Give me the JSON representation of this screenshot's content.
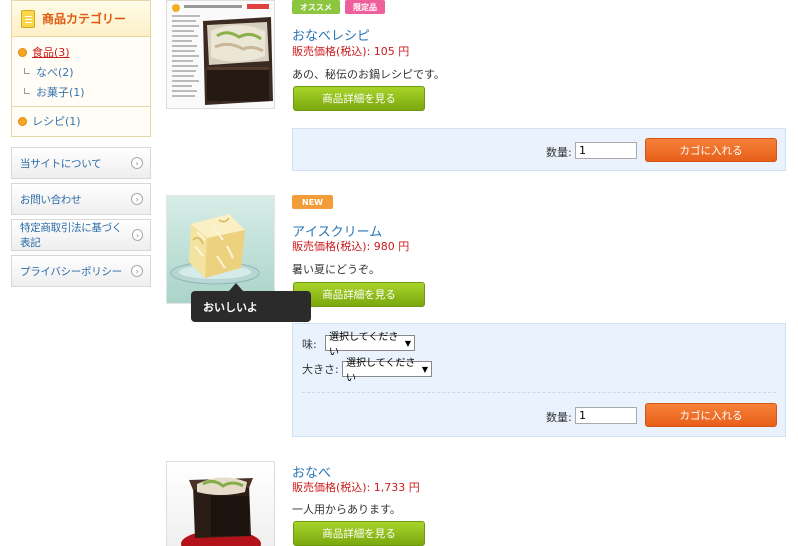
{
  "sidebar": {
    "category_title": "商品カテゴリー",
    "categories": [
      {
        "label": "食品(3)"
      },
      {
        "label": "なべ(2)"
      },
      {
        "label": "お菓子(1)"
      },
      {
        "label": "レシピ(1)"
      }
    ],
    "links": [
      {
        "label": "当サイトについて"
      },
      {
        "label": "お問い合わせ"
      },
      {
        "label": "特定商取引法に基づく表記"
      },
      {
        "label": "プライバシーポリシー"
      }
    ]
  },
  "products": [
    {
      "tags": [
        "オススメ",
        "限定品"
      ],
      "tag_colors": [
        "#8cc63e",
        "#ef5f9b"
      ],
      "name": "おなべレシピ",
      "price": "販売価格(税込): 105 円",
      "description": "あの、秘伝のお鍋レシピです。",
      "detail_label": "商品詳細を見る",
      "qty_label": "数量:",
      "qty_value": "1",
      "cart_label": "カゴに入れる"
    },
    {
      "tags": [
        "NEW"
      ],
      "tag_colors": [
        "#f39c3a"
      ],
      "name": "アイスクリーム",
      "price": "販売価格(税込): 980 円",
      "description": "暑い夏にどうぞ。",
      "detail_label": "商品詳細を見る",
      "tooltip": "おいしいよ",
      "options": [
        {
          "label": "味:",
          "value": "選択してください"
        },
        {
          "label": "大きさ:",
          "value": "選択してください"
        }
      ],
      "qty_label": "数量:",
      "qty_value": "1",
      "cart_label": "カゴに入れる"
    },
    {
      "name": "おなべ",
      "price": "販売価格(税込): 1,733 円",
      "description": "一人用からあります。",
      "detail_label": "商品詳細を見る"
    }
  ],
  "colors": {
    "accent_orange": "#e8601a",
    "button_green": "#8cbf1f",
    "link_blue": "#2a76b6",
    "price_red": "#cc1b1b"
  },
  "icons": [
    "document-icon",
    "bullet-icon",
    "chevron-right-icon",
    "dropdown-arrow-icon"
  ]
}
